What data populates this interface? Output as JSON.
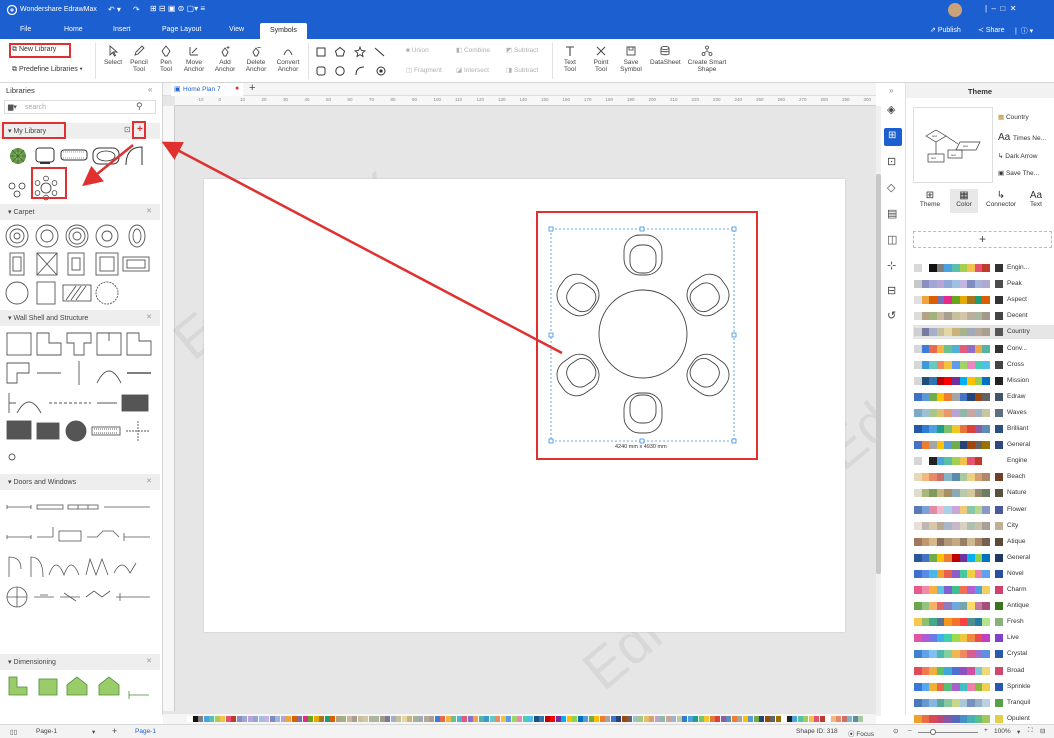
{
  "app": {
    "title": "Wondershare EdrawMax",
    "menus": [
      "File",
      "Home",
      "Insert",
      "Page Layout",
      "View",
      "Symbols"
    ],
    "active_menu": "Symbols",
    "publish_label": "Publish",
    "share_label": "Share"
  },
  "ribbon": {
    "new_library": "New Library",
    "predefine_libraries": "Predefine Libraries",
    "tools": [
      {
        "icon": "select-arrow-icon",
        "label": "Select"
      },
      {
        "icon": "pencil-icon",
        "label": "Pencil\nTool"
      },
      {
        "icon": "pen-icon",
        "label": "Pen\nTool"
      },
      {
        "icon": "move-anchor-icon",
        "label": "Move\nAnchor"
      },
      {
        "icon": "add-anchor-icon",
        "label": "Add\nAnchor"
      },
      {
        "icon": "delete-anchor-icon",
        "label": "Delete\nAnchor"
      },
      {
        "icon": "convert-anchor-icon",
        "label": "Convert\nAnchor"
      }
    ],
    "boolean_ops": [
      "Union",
      "Combine",
      "Subtract",
      "Fragment",
      "Intersect",
      "Subtract"
    ],
    "tools2": [
      {
        "icon": "text-icon",
        "label": "Text\nTool"
      },
      {
        "icon": "point-icon",
        "label": "Point\nTool"
      },
      {
        "icon": "save-symbol-icon",
        "label": "Save\nSymbol"
      },
      {
        "icon": "datasheet-icon",
        "label": "DataSheet"
      },
      {
        "icon": "smart-shape-icon",
        "label": "Create Smart\nShape"
      }
    ]
  },
  "library": {
    "title": "Libraries",
    "search_placeholder": "search",
    "sections": [
      "My Library",
      "Carpet",
      "Wall Shell and Structure",
      "Doors and Windows",
      "Dimensioning"
    ]
  },
  "document": {
    "tab_name": "Home Plan 7",
    "ruler_labels": [
      "-10",
      "0",
      "10",
      "20",
      "30",
      "40",
      "50",
      "60",
      "70",
      "80",
      "90",
      "100",
      "110",
      "120",
      "130",
      "140",
      "150",
      "160",
      "170",
      "180",
      "190",
      "200",
      "210",
      "220",
      "230",
      "240",
      "250",
      "260",
      "270",
      "280",
      "290",
      "300"
    ],
    "dimension_label": "4240 mm x 4930 mm",
    "watermark": "EdrawMax"
  },
  "theme_panel": {
    "title": "Theme",
    "quick_items": [
      "Country",
      "Times Ne...",
      "Dark Arrow",
      "Save The..."
    ],
    "tabs": [
      "Theme",
      "Color",
      "Connector",
      "Text"
    ],
    "add_symbol": "+",
    "selected_theme": "Country",
    "themes": [
      {
        "name": "Engin...",
        "colors": [
          "#d9d9d9",
          "#ffffff",
          "#111111",
          "#7f7f7f",
          "#4aa3df",
          "#5bc0a8",
          "#a4cf4f",
          "#f2c14e",
          "#e5546e",
          "#c0392b",
          "#333333"
        ]
      },
      {
        "name": "Peak",
        "colors": [
          "#c8c8c8",
          "#8a8fbf",
          "#a0a6d6",
          "#b9a6d6",
          "#8fa8d8",
          "#9fc0e0",
          "#c4b5e0",
          "#7e8cc4",
          "#a3b4dd",
          "#b0a8d0",
          "#4c4c4c"
        ]
      },
      {
        "name": "Aspect",
        "colors": [
          "#e0e0e0",
          "#f1a340",
          "#d95f02",
          "#7570b3",
          "#e7298a",
          "#66a61e",
          "#e6ab02",
          "#a6761d",
          "#1b9e77",
          "#d95f02",
          "#333333"
        ]
      },
      {
        "name": "Decent",
        "colors": [
          "#dcdcdc",
          "#b3a284",
          "#9fb37a",
          "#c9b7a0",
          "#a89f91",
          "#c8c09c",
          "#d4c5a8",
          "#b7b09c",
          "#aab7a0",
          "#a3998a",
          "#444444"
        ]
      },
      {
        "name": "Country",
        "colors": [
          "#cfcfcf",
          "#7a7aa0",
          "#a3b0c8",
          "#c8c09c",
          "#e3d7a6",
          "#cbb27a",
          "#a6b38c",
          "#9fa9b7",
          "#b5a99c",
          "#a89f91",
          "#555555"
        ]
      },
      {
        "name": "Conv...",
        "colors": [
          "#d6d6d6",
          "#3b7dd8",
          "#e96a4a",
          "#f2b544",
          "#6cc08b",
          "#4fb3d9",
          "#e25c7a",
          "#8f6ec8",
          "#f0a64a",
          "#55b4a0",
          "#333333"
        ]
      },
      {
        "name": "Cross",
        "colors": [
          "#d6d6d6",
          "#3a9ad9",
          "#6cc7c0",
          "#f08a5d",
          "#f3c13a",
          "#5d9cec",
          "#a0d468",
          "#ec87c0",
          "#48cfad",
          "#4fc1e9",
          "#444444"
        ]
      },
      {
        "name": "Mission",
        "colors": [
          "#d6d6d6",
          "#1f4e79",
          "#2e75b6",
          "#c00000",
          "#ff0000",
          "#7030a0",
          "#00b0f0",
          "#ffc000",
          "#92d050",
          "#0070c0",
          "#222222"
        ]
      },
      {
        "name": "Edraw",
        "colors": [
          "#3f6fc6",
          "#5b9bd5",
          "#70ad47",
          "#ffc000",
          "#ed7d31",
          "#a5a5a5",
          "#4472c4",
          "#264478",
          "#9e480e",
          "#636363",
          "#44546a"
        ]
      },
      {
        "name": "Waves",
        "colors": [
          "#7fa7c9",
          "#9bc1d4",
          "#a8c686",
          "#e0c06d",
          "#e49a6a",
          "#b9a3d0",
          "#8fb8a8",
          "#c9a7a0",
          "#a0b4c8",
          "#c6c6a0",
          "#5e6f80"
        ]
      },
      {
        "name": "Brilliant",
        "colors": [
          "#2457a6",
          "#2f7dd1",
          "#4fa0e0",
          "#1f9e89",
          "#7ac36a",
          "#f0c929",
          "#e8743b",
          "#d9433b",
          "#8e5ea2",
          "#5e8db6",
          "#2b4f81"
        ]
      },
      {
        "name": "General",
        "colors": [
          "#4472c4",
          "#ed7d31",
          "#a5a5a5",
          "#ffc000",
          "#5b9bd5",
          "#70ad47",
          "#264478",
          "#9e480e",
          "#636363",
          "#997300",
          "#2e4a7a"
        ]
      },
      {
        "name": "Engine",
        "colors": [
          "#d6d6d6",
          "#ffffff",
          "#222222",
          "#4aa3df",
          "#5bc0a8",
          "#a4cf4f",
          "#f2c14e",
          "#e5546e",
          "#c0392b",
          "#ffffff",
          "#ffffff"
        ]
      },
      {
        "name": "Beach",
        "colors": [
          "#e8d8b8",
          "#f2b880",
          "#e8896a",
          "#c9706b",
          "#84b4c8",
          "#5d8ca8",
          "#a8c8a0",
          "#f0d080",
          "#d4a070",
          "#b08868",
          "#6b4226"
        ]
      },
      {
        "name": "Nature",
        "colors": [
          "#e0dccc",
          "#a8b87a",
          "#7e9a5c",
          "#c8b480",
          "#a89060",
          "#8ca8b8",
          "#b8c8a8",
          "#d4c89c",
          "#98886c",
          "#6c8060",
          "#5a5040"
        ]
      },
      {
        "name": "Flower",
        "colors": [
          "#5a7ab8",
          "#7ca0d8",
          "#e08aa8",
          "#f0b8c8",
          "#a8d0e8",
          "#c8a8d8",
          "#f0c878",
          "#88c8a8",
          "#b8d888",
          "#8898c8",
          "#4a5a98"
        ]
      },
      {
        "name": "City",
        "colors": [
          "#e8e0d8",
          "#c0b8b0",
          "#d8c8a8",
          "#b8a898",
          "#a8b8c8",
          "#c8b8c8",
          "#d8d0c0",
          "#b0c0b0",
          "#c8c0a8",
          "#a8a098",
          "#c0b098"
        ]
      },
      {
        "name": "Atique",
        "colors": [
          "#a07860",
          "#c09870",
          "#d8b888",
          "#8a7060",
          "#b09878",
          "#c8a880",
          "#988068",
          "#d0b890",
          "#a88868",
          "#786050",
          "#5a4838"
        ]
      },
      {
        "name": "General",
        "colors": [
          "#2b579a",
          "#4472c4",
          "#70ad47",
          "#ffc000",
          "#ed7d31",
          "#c00000",
          "#7030a0",
          "#00b0f0",
          "#92d050",
          "#0070c0",
          "#1f3864"
        ]
      },
      {
        "name": "Novel",
        "colors": [
          "#3c6fd0",
          "#5a8ae8",
          "#48b8e8",
          "#f0a030",
          "#e86050",
          "#8a60c8",
          "#48c8a0",
          "#f0d040",
          "#e880b0",
          "#60a0f0",
          "#2a4fa0"
        ]
      },
      {
        "name": "Charm",
        "colors": [
          "#e85a8a",
          "#f08aa8",
          "#f8b040",
          "#60c0e0",
          "#8060d0",
          "#40c090",
          "#f07050",
          "#b060d0",
          "#50a0e0",
          "#f0d060",
          "#d04070"
        ]
      },
      {
        "name": "Antique",
        "colors": [
          "#6aa84f",
          "#93c47d",
          "#f6b26b",
          "#e06666",
          "#8e7cc3",
          "#6fa8dc",
          "#76a5af",
          "#ffd966",
          "#c27ba0",
          "#a64d79",
          "#38761d"
        ]
      },
      {
        "name": "Fresh",
        "colors": [
          "#f9c74f",
          "#90be6d",
          "#43aa8b",
          "#577590",
          "#f8961e",
          "#f3722c",
          "#f94144",
          "#4d908e",
          "#277da1",
          "#b5e48c",
          "#8ab17d"
        ]
      },
      {
        "name": "Live",
        "colors": [
          "#e056a0",
          "#b05ad8",
          "#6a7ae8",
          "#40b0e8",
          "#40d0b0",
          "#a0d850",
          "#f0c840",
          "#f08840",
          "#e85050",
          "#c040c0",
          "#8040c8"
        ]
      },
      {
        "name": "Crystal",
        "colors": [
          "#4080d0",
          "#60a0e8",
          "#80c0f0",
          "#50b8a8",
          "#80d0a0",
          "#f0b850",
          "#f08860",
          "#d86090",
          "#a070d0",
          "#6090e0",
          "#2a5aa8"
        ]
      },
      {
        "name": "Broad",
        "colors": [
          "#e04a5a",
          "#f07a50",
          "#f0b040",
          "#60c060",
          "#40a8d8",
          "#5070d0",
          "#9050c0",
          "#d050a0",
          "#80c8d8",
          "#f0d878",
          "#d04870"
        ]
      },
      {
        "name": "Sprinkle",
        "colors": [
          "#3a78d8",
          "#58a8f0",
          "#f0b030",
          "#e86850",
          "#58c078",
          "#a860d0",
          "#40c0c0",
          "#f080a8",
          "#88b840",
          "#f0d050",
          "#2858b0"
        ]
      },
      {
        "name": "Tranquil",
        "colors": [
          "#4878b8",
          "#6898d0",
          "#88b8e0",
          "#58a898",
          "#88c8a0",
          "#c8d888",
          "#a8c8d8",
          "#7890c0",
          "#98b0d0",
          "#b8d0e0",
          "#58a048"
        ]
      },
      {
        "name": "Opulent",
        "colors": [
          "#f0a030",
          "#e87040",
          "#d84858",
          "#b84878",
          "#8858a8",
          "#5868b8",
          "#4890c8",
          "#48b0b0",
          "#58c088",
          "#a0c858",
          "#e0d048"
        ]
      }
    ]
  },
  "status": {
    "page_label": "Page-1",
    "page_tab": "Page-1",
    "shape_id": "Shape ID: 318",
    "focus": "Focus",
    "zoom": "100%"
  },
  "colors": {
    "brand_blue": "#1c5fd0",
    "highlight_red": "#e03030",
    "selection_blue": "#3a8fe0"
  }
}
